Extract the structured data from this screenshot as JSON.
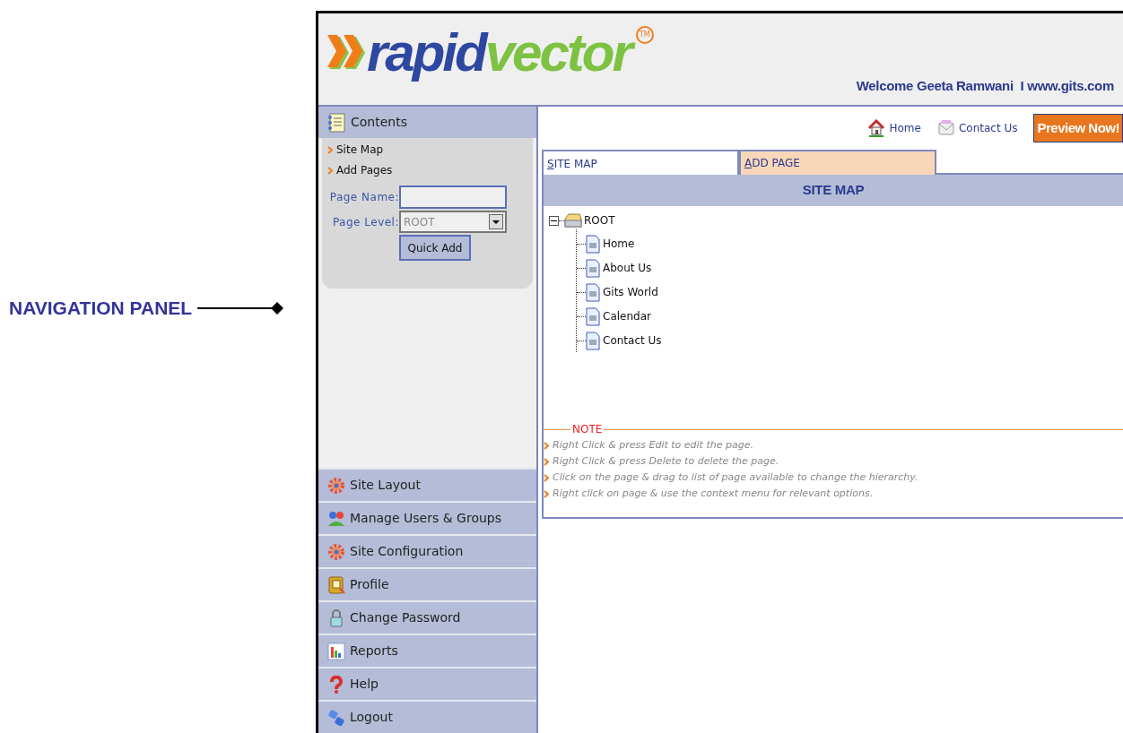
{
  "annotation": {
    "label": "NAVIGATION PANEL"
  },
  "header": {
    "logo": {
      "first": "rapid",
      "second": "vector",
      "mark": "TM"
    },
    "welcome": "Welcome Geeta Ramwani  I www.gits.com"
  },
  "sidebar": {
    "contents_title": "Contents",
    "links": [
      "Site Map",
      "Add Pages"
    ],
    "form": {
      "page_name": {
        "label": "Page Name:"
      },
      "page_level": {
        "label": "Page Level:",
        "value": "ROOT"
      },
      "button": "Quick Add"
    },
    "nav": [
      {
        "label": "Site Layout"
      },
      {
        "label": "Manage Users & Groups"
      },
      {
        "label": "Site Configuration"
      },
      {
        "label": "Profile"
      },
      {
        "label": "Change Password"
      },
      {
        "label": "Reports"
      },
      {
        "label": "Help"
      },
      {
        "label": "Logout"
      }
    ]
  },
  "toolbar": {
    "links": [
      "Home",
      "Contact Us"
    ],
    "button": "Preview Now!"
  },
  "tabs": [
    {
      "label": "SITE MAP",
      "selected": true
    },
    {
      "label": "ADD PAGE",
      "selected": false
    }
  ],
  "panel_title": "SITE MAP",
  "tree": {
    "label": "ROOT",
    "expanded": true,
    "children": [
      {
        "label": "Home"
      },
      {
        "label": "About Us"
      },
      {
        "label": "Gits World"
      },
      {
        "label": "Calendar"
      },
      {
        "label": "Contact Us"
      }
    ]
  },
  "note": {
    "title": "NOTE",
    "items": [
      "Right Click & press Edit to edit the page.",
      "Right Click & press Delete to delete the page.",
      "Click on the page & drag to list of page available to change the hierarchy.",
      "Right click on page & use the context menu for relevant options."
    ]
  }
}
